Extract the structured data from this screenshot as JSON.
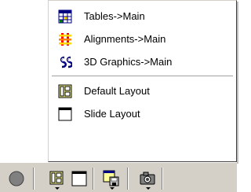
{
  "menu": {
    "items": [
      {
        "label": "Tables->Main",
        "icon": "table-icon"
      },
      {
        "label": "Alignments->Main",
        "icon": "alignments-icon"
      },
      {
        "label": "3D Graphics->Main",
        "icon": "3d-graphics-icon"
      },
      {
        "label": "Default Layout",
        "icon": "default-layout-icon"
      },
      {
        "label": "Slide Layout",
        "icon": "slide-layout-icon"
      }
    ]
  },
  "toolbar": {
    "buttons": [
      {
        "name": "record-button",
        "icon": "circle-icon"
      },
      {
        "name": "layout-menu-button",
        "icon": "default-layout-icon"
      },
      {
        "name": "slide-layout-button",
        "icon": "slide-layout-icon"
      },
      {
        "name": "save-window-button",
        "icon": "save-window-icon"
      },
      {
        "name": "camera-button",
        "icon": "camera-icon"
      }
    ]
  },
  "colors": {
    "menu_background": "#ffffff",
    "toolbar_background": "#d4d0c8"
  }
}
